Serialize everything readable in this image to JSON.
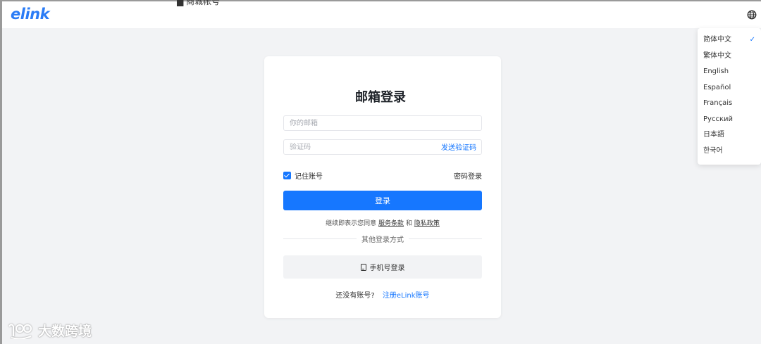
{
  "header": {
    "logo": "elink",
    "fragment_text": "▆ 商城帐号",
    "globe_icon": "globe-icon"
  },
  "language_menu": {
    "items": [
      "简体中文",
      "繁体中文",
      "English",
      "Español",
      "Français",
      "Русский",
      "日本語",
      "한국어"
    ],
    "selected": "简体中文",
    "check_mark": "✓"
  },
  "login": {
    "title": "邮箱登录",
    "email_placeholder": "你的邮箱",
    "code_placeholder": "验证码",
    "send_code_label": "发送验证码",
    "remember_label": "记住账号",
    "remember_checked": true,
    "password_login_label": "密码登录",
    "login_button_label": "登录",
    "terms_prefix": "继续即表示您同意",
    "terms_service": "服务条款",
    "terms_and": "和",
    "terms_privacy": "隐私政策",
    "other_methods_label": "其他登录方式",
    "phone_login_label": "手机号登录",
    "register_prompt": "还没有账号?",
    "register_link": "注册eLink账号"
  },
  "watermark": {
    "text": "大数跨境"
  },
  "colors": {
    "accent": "#1677ff",
    "logo": "#2b7cf6",
    "background": "#f2f3f5"
  }
}
